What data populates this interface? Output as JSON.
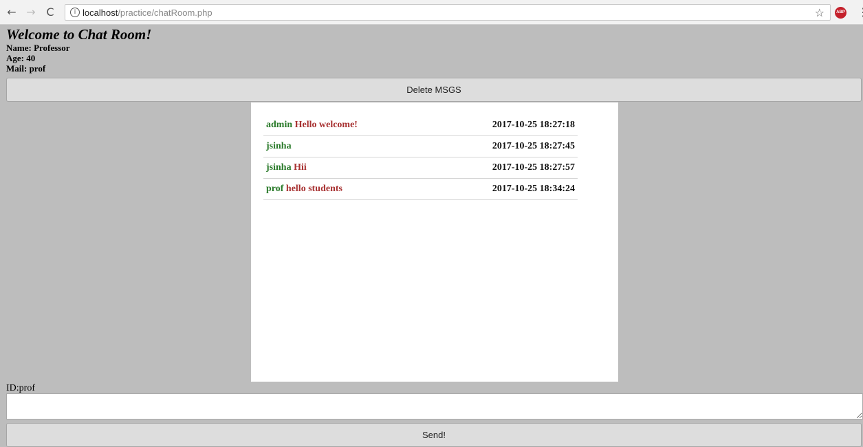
{
  "browser": {
    "url_host": "localhost",
    "url_path": "/practice/chatRoom.php",
    "back_icon": "←",
    "forward_icon": "→",
    "reload_icon": "C",
    "info_icon": "i",
    "star_icon": "☆",
    "abp_label": "ABP",
    "menu_icon": "⋮"
  },
  "page": {
    "title": "Welcome to Chat Room!",
    "name_line": "Name: Professor",
    "age_line": "Age: 40",
    "mail_line": "Mail: prof",
    "delete_label": "Delete MSGS",
    "id_label": "ID:prof",
    "input_value": "",
    "send_label": "Send!"
  },
  "messages": [
    {
      "user": "admin",
      "text": "Hello welcome!",
      "time": "2017-10-25 18:27:18"
    },
    {
      "user": "jsinha",
      "text": "",
      "time": "2017-10-25 18:27:45"
    },
    {
      "user": "jsinha",
      "text": "Hii",
      "time": "2017-10-25 18:27:57"
    },
    {
      "user": "prof",
      "text": "hello students",
      "time": "2017-10-25 18:34:24"
    }
  ],
  "colors": {
    "page_bg": "#bdbdbd",
    "user_color": "#2a7a2a",
    "text_color": "#a83232"
  }
}
